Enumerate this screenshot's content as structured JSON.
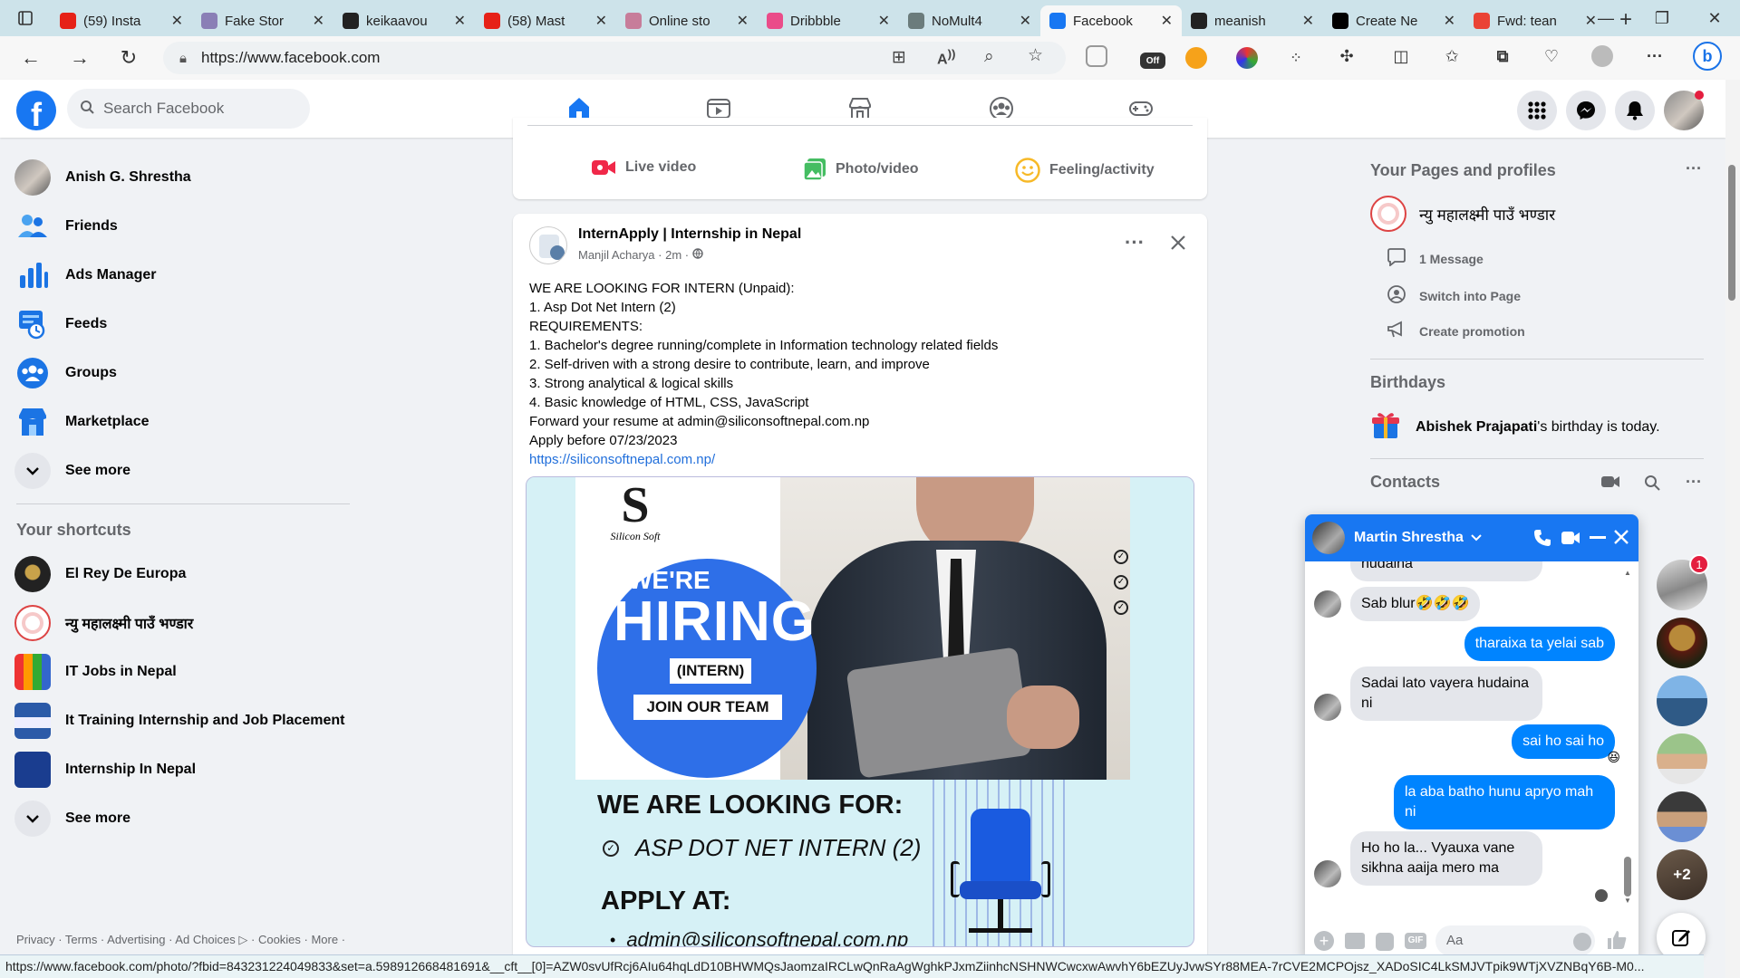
{
  "browser": {
    "tabs": [
      {
        "label": "(59) Insta",
        "icon": "youtube-icon",
        "color": "#e62117"
      },
      {
        "label": "Fake Stor",
        "icon": "page-icon",
        "color": "#8a7fb6"
      },
      {
        "label": "keikaavou",
        "icon": "github-icon",
        "color": "#222222"
      },
      {
        "label": "(58) Mast",
        "icon": "youtube-icon",
        "color": "#e62117"
      },
      {
        "label": "Online sto",
        "icon": "dribbble-ball-icon",
        "color": "#c77d9a"
      },
      {
        "label": "Dribbble",
        "icon": "dribbble-icon",
        "color": "#ea4c89"
      },
      {
        "label": "NoMult4",
        "icon": "openai-icon",
        "color": "#6b7c7c"
      },
      {
        "label": "Facebook",
        "icon": "facebook-icon",
        "color": "#1877f2",
        "active": true
      },
      {
        "label": "meanish",
        "icon": "github-icon",
        "color": "#222222"
      },
      {
        "label": "Create Ne",
        "icon": "vercel-icon",
        "color": "#000000"
      },
      {
        "label": "Fwd: tean",
        "icon": "gmail-icon",
        "color": "#ea4335"
      }
    ],
    "url": "https://www.facebook.com",
    "status_url": "https://www.facebook.com/photo/?fbid=843231224049833&set=a.598912668481691&__cft__[0]=AZW0svUfRcj6AIu64hqLdD10BHWMQsJaomzaIRCLwQnRaAgWghkPJxmZiinhcNSHNWCwcxwAwvhY6bEZUyJvwSYr88MEA-7rCVE2MCPOjsz_XADoSIC4LkSMJVTpik9WTjXVZNBqY6B-M0..."
  },
  "facebook": {
    "search_placeholder": "Search Facebook",
    "left_nav": [
      {
        "label": "Anish G. Shrestha",
        "icon": "profile-avatar"
      },
      {
        "label": "Friends",
        "icon": "friends-icon"
      },
      {
        "label": "Ads Manager",
        "icon": "ads-manager-icon"
      },
      {
        "label": "Feeds",
        "icon": "feeds-icon"
      },
      {
        "label": "Groups",
        "icon": "groups-icon"
      },
      {
        "label": "Marketplace",
        "icon": "marketplace-icon"
      },
      {
        "label": "See more",
        "icon": "chevron-down-icon"
      }
    ],
    "shortcuts_title": "Your shortcuts",
    "shortcuts": [
      {
        "label": "El Rey De Europa"
      },
      {
        "label": "न्यु महालक्ष्मी पाउँ भण्डार"
      },
      {
        "label": "IT Jobs in Nepal"
      },
      {
        "label": "It Training Internship and Job Placement"
      },
      {
        "label": "Internship In Nepal"
      },
      {
        "label": "See more"
      }
    ],
    "footer": "Privacy · Terms · Advertising · Ad Choices ▷ · Cookies · More ·",
    "composer": {
      "live": "Live video",
      "photo": "Photo/video",
      "feeling": "Feeling/activity"
    },
    "post": {
      "page_name": "InternApply | Internship in Nepal",
      "meta": "Manjil Acharya · 2m ·",
      "lines": [
        "WE ARE LOOKING FOR INTERN (Unpaid):",
        "1. Asp Dot Net Intern (2)",
        "REQUIREMENTS:",
        "1. Bachelor's degree running/complete in Information technology related fields",
        "2. Self-driven with a strong desire to contribute, learn, and improve",
        "3. Strong analytical & logical skills",
        "4. Basic knowledge of HTML, CSS, JavaScript",
        "Forward your resume at admin@siliconsoftnepal.com.np",
        "Apply before 07/23/2023"
      ],
      "link": "https://siliconsoftnepal.com.np/",
      "image": {
        "brand": "Silicon Soft",
        "were": "WE'RE",
        "hiring": "HIRING",
        "intern": "(INTERN)",
        "join": "JOIN OUR TEAM",
        "looking": "WE ARE LOOKING FOR:",
        "position": "ASP DOT NET INTERN (2)",
        "apply": "APPLY AT:",
        "email": "admin@siliconsoftnepal.com.np"
      }
    },
    "right": {
      "pages_title": "Your Pages and profiles",
      "page_name": "न्यु महालक्ष्मी पाउँ भण्डार",
      "page_actions": [
        "1 Message",
        "Switch into Page",
        "Create promotion"
      ],
      "birthdays_title": "Birthdays",
      "birthday_name": "Abishek Prajapati",
      "birthday_rest": "'s birthday is today.",
      "contacts_title": "Contacts"
    },
    "chat": {
      "name": "Martin Shrestha",
      "messages": [
        {
          "dir": "in",
          "text": "hudaina"
        },
        {
          "dir": "in",
          "text": "Sab blur🤣🤣🤣"
        },
        {
          "dir": "out",
          "text": "tharaixa ta yelai sab"
        },
        {
          "dir": "in",
          "text": "Sadai lato vayera hudaina ni"
        },
        {
          "dir": "out",
          "text": "sai ho sai ho"
        },
        {
          "dir": "out",
          "text": "la aba batho hunu apryo mah ni"
        },
        {
          "dir": "in",
          "text": "Ho ho la... Vyauxa vane sikhna aaija mero ma"
        }
      ],
      "input_placeholder": "Aa",
      "unread_badge": "1",
      "more_contacts": "+2"
    }
  }
}
